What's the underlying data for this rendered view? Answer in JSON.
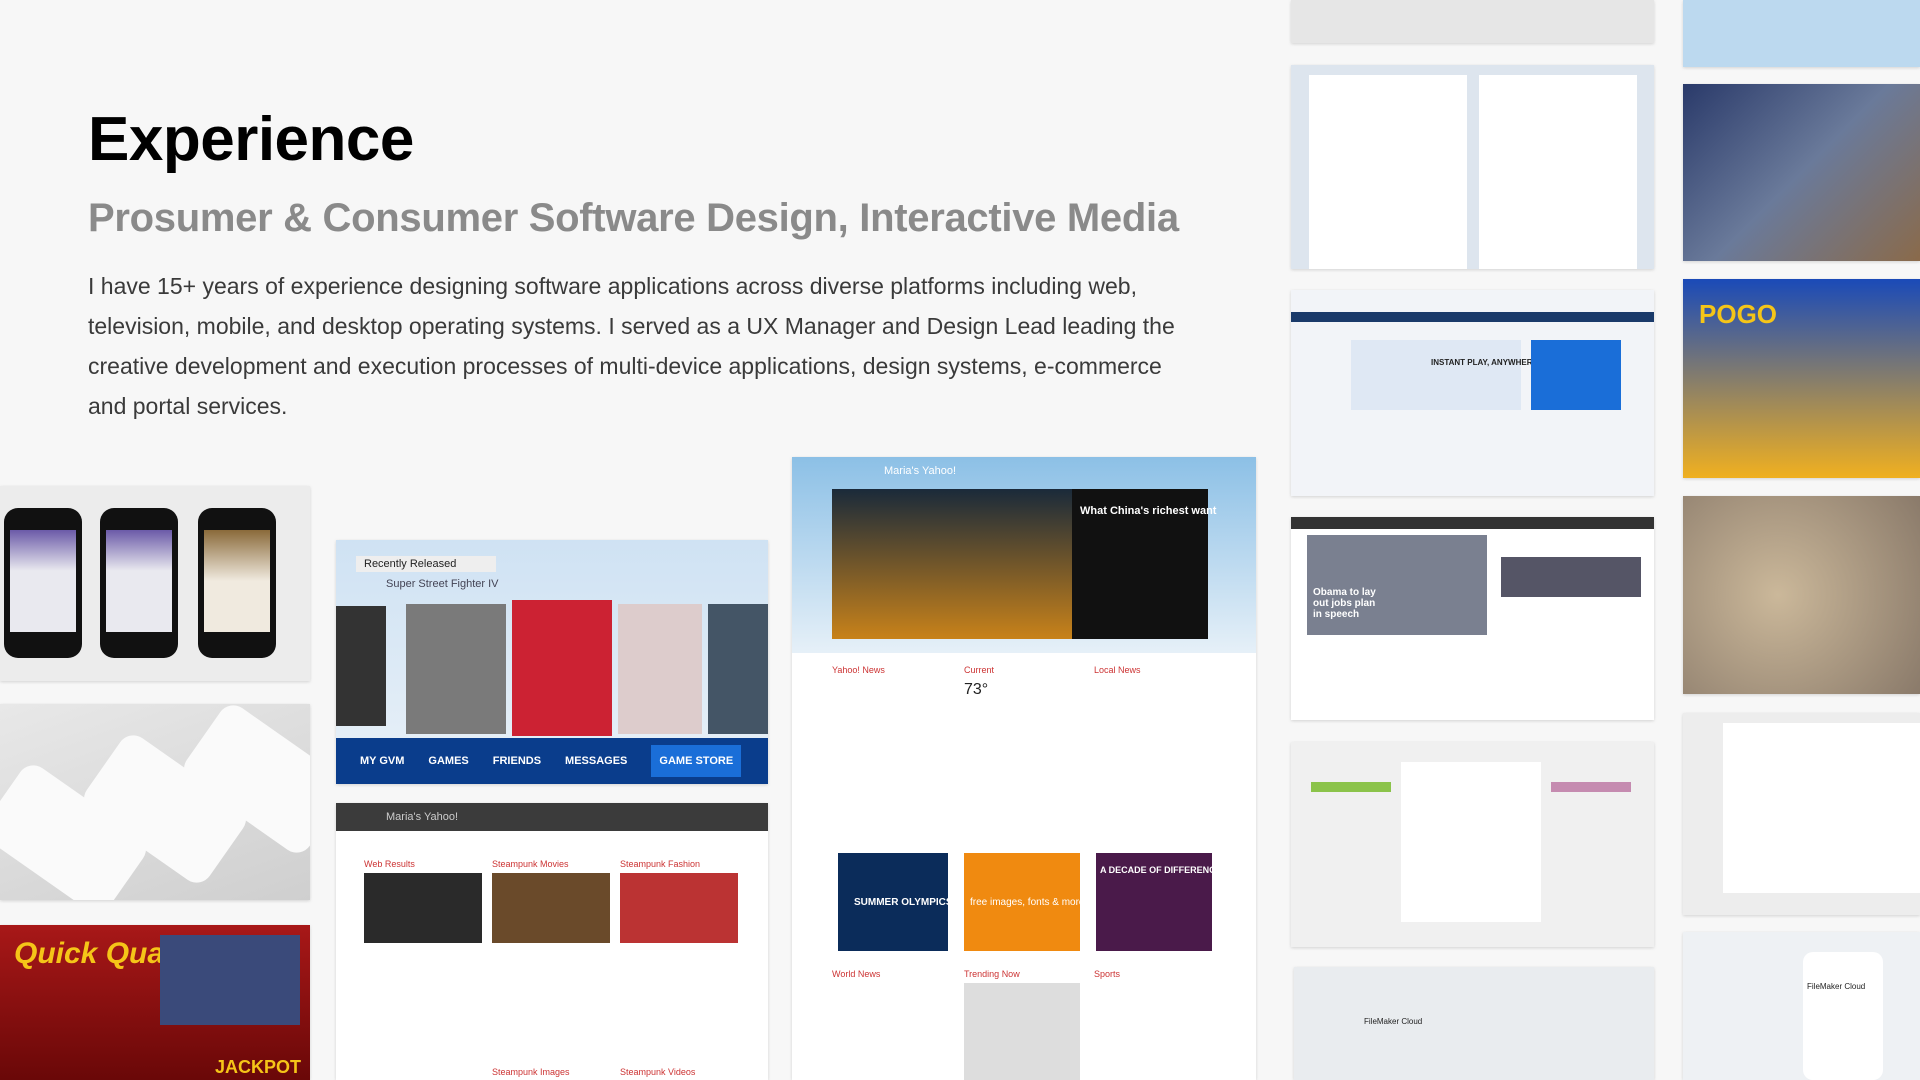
{
  "header": {
    "title": "Experience",
    "subtitle": "Prosumer & Consumer Software Design, Interactive Media",
    "description": "I have 15+ years of experience designing software applications across diverse platforms including web, television, mobile, and desktop operating systems. I served as a UX Manager and Design Lead leading the creative development and execution processes of multi-device applications, design systems, e-commerce and portal services."
  },
  "gallery": {
    "game_console": {
      "recently_released": "Recently Released",
      "featured": "Super Street Fighter IV",
      "nav": [
        "MY GVM",
        "GAMES",
        "FRIENDS",
        "MESSAGES",
        "GAME STORE"
      ]
    },
    "yahoo_portal": {
      "brand": "Maria's Yahoo!",
      "headline": "What China's richest want",
      "sections": [
        "Yahoo! News",
        "Current",
        "Local News",
        "World News",
        "Trending Now",
        "Sports"
      ],
      "temperature": "73°",
      "promos": [
        "SUMMER OLYMPICS",
        "free images, fonts & more",
        "A DECADE OF DIFFERENCE"
      ]
    },
    "yahoo_search": {
      "brand": "Maria's Yahoo!",
      "sections": [
        "Web Results",
        "Steampunk Movies",
        "Steampunk Fashion",
        "Steampunk Images",
        "Steampunk Videos"
      ]
    },
    "news_site": {
      "headline": "Obama to lay out jobs plan in speech"
    },
    "product_site": {
      "headline": "INSTANT PLAY, ANYWHERE"
    },
    "slot_game": {
      "title": "Quick Quack",
      "jackpot": "JACKPOT"
    },
    "pogo": {
      "brand": "POGO"
    },
    "filemaker": {
      "title": "FileMaker Cloud"
    }
  }
}
